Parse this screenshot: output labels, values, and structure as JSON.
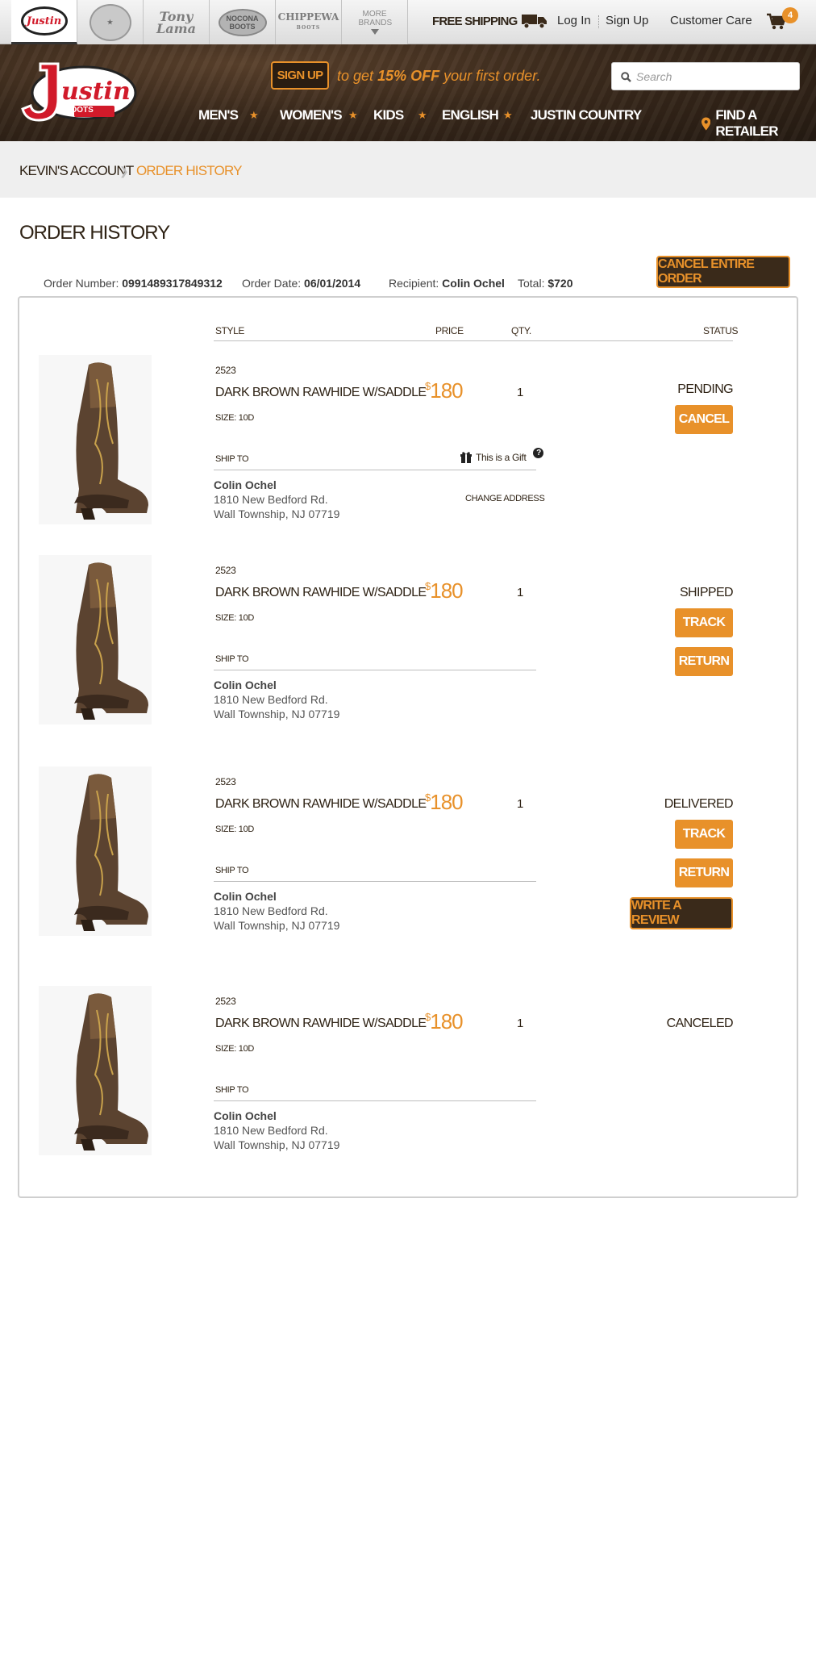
{
  "brandbar": {
    "tabs": [
      {
        "label": "Justin"
      },
      {
        "label": "Justin Work"
      },
      {
        "label": "Tony Lama"
      },
      {
        "label": "Nocona Boots"
      },
      {
        "label": "Chippewa"
      },
      {
        "label": "More Brands"
      }
    ],
    "nocona": "NOCONA BOOTS",
    "chippewa": "CHIPPEWA",
    "chippewa_sub": "BOOTS",
    "tonylama": "Tony Lama",
    "more": "MORE BRANDS"
  },
  "topnav": {
    "free_shipping": "FREE SHIPPING",
    "login": "Log In",
    "signup": "Sign Up",
    "customer_care": "Customer Care",
    "cart_count": "4"
  },
  "header": {
    "logo_text": "Justin",
    "logo_sub": "BOOTS",
    "signup_btn": "SIGN UP",
    "promo_pre": "to get",
    "promo_bold": "15% OFF",
    "promo_post": "your first order.",
    "search_placeholder": "Search",
    "nav": [
      "MEN'S",
      "WOMEN'S",
      "KIDS",
      "ENGLISH",
      "JUSTIN COUNTRY"
    ],
    "find_retailer": "FIND A RETAILER"
  },
  "breadcrumb": {
    "account": "KEVIN'S ACCOUNT",
    "current": "ORDER HISTORY"
  },
  "page": {
    "title": "ORDER HISTORY",
    "order_number_label": "Order Number:",
    "order_number": "0991489317849312",
    "order_date_label": "Order Date:",
    "order_date": "06/01/2014",
    "recipient_label": "Recipient:",
    "recipient": "Colin Ochel",
    "total_label": "Total:",
    "total": "$720",
    "cancel_all": "CANCEL ENTIRE ORDER"
  },
  "columns": {
    "style": "STYLE",
    "price": "PRICE",
    "qty": "QTY.",
    "status": "STATUS"
  },
  "items": [
    {
      "sku": "2523",
      "name": "DARK BROWN RAWHIDE W/SADDLE",
      "size": "SIZE: 10D",
      "currency": "$",
      "price": "180",
      "qty": "1",
      "status": "PENDING",
      "ship_to": "SHIP TO",
      "recipient": "Colin Ochel",
      "addr1": "1810 New Bedford Rd.",
      "addr2": "Wall Township, NJ 07719",
      "gift": "This is a Gift",
      "change_address": "CHANGE ADDRESS",
      "cancel": "CANCEL"
    },
    {
      "sku": "2523",
      "name": "DARK BROWN RAWHIDE W/SADDLE",
      "size": "SIZE: 10D",
      "currency": "$",
      "price": "180",
      "qty": "1",
      "status": "SHIPPED",
      "ship_to": "SHIP TO",
      "recipient": "Colin Ochel",
      "addr1": "1810 New Bedford Rd.",
      "addr2": "Wall Township, NJ 07719",
      "track": "TRACK",
      "return": "RETURN"
    },
    {
      "sku": "2523",
      "name": "DARK BROWN RAWHIDE W/SADDLE",
      "size": "SIZE: 10D",
      "currency": "$",
      "price": "180",
      "qty": "1",
      "status": "DELIVERED",
      "ship_to": "SHIP TO",
      "recipient": "Colin Ochel",
      "addr1": "1810 New Bedford Rd.",
      "addr2": "Wall Township, NJ 07719",
      "track": "TRACK",
      "return": "RETURN",
      "review": "WRITE A REVIEW"
    },
    {
      "sku": "2523",
      "name": "DARK BROWN RAWHIDE W/SADDLE",
      "size": "SIZE: 10D",
      "currency": "$",
      "price": "180",
      "qty": "1",
      "status": "CANCELED",
      "ship_to": "SHIP TO",
      "recipient": "Colin Ochel",
      "addr1": "1810 New Bedford Rd.",
      "addr2": "Wall Township, NJ 07719"
    }
  ],
  "colors": {
    "accent": "#e8912a",
    "dark_brown": "#3a2a1a",
    "brand_red": "#d11a2a"
  }
}
